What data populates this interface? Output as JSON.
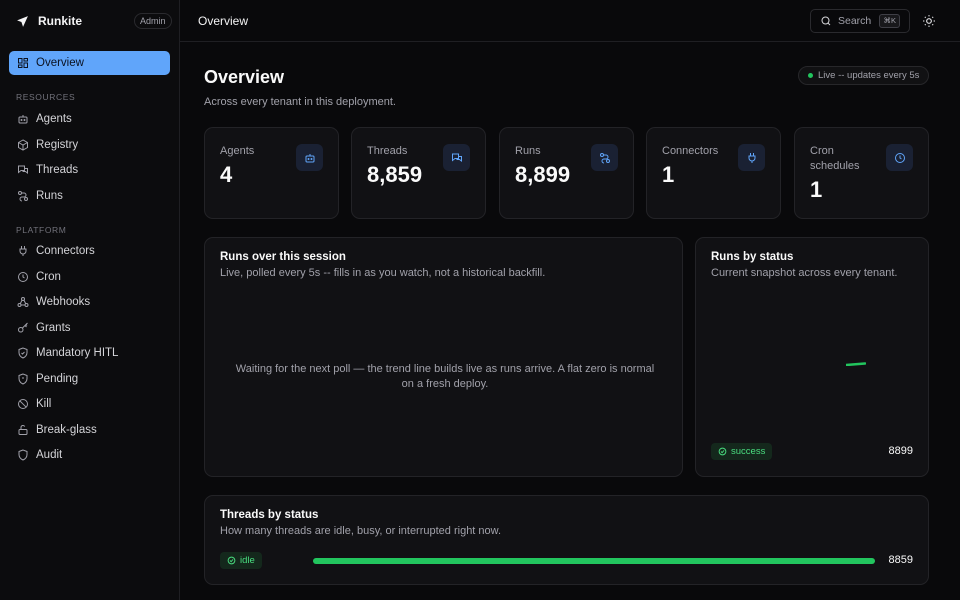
{
  "brand": {
    "name": "Runkite",
    "badge": "Admin"
  },
  "sidebar": {
    "overview": "Overview",
    "sections": [
      {
        "label": "RESOURCES",
        "items": [
          "Agents",
          "Registry",
          "Threads",
          "Runs"
        ]
      },
      {
        "label": "PLATFORM",
        "items": [
          "Connectors",
          "Cron",
          "Webhooks",
          "Grants",
          "Mandatory HITL",
          "Pending",
          "Kill",
          "Break-glass",
          "Audit"
        ]
      }
    ]
  },
  "topbar": {
    "title": "Overview",
    "search_label": "Search",
    "search_shortcut": "⌘K"
  },
  "page": {
    "title": "Overview",
    "subtitle": "Across every tenant in this deployment.",
    "live": "Live -- updates every 5s"
  },
  "stats": [
    {
      "label": "Agents",
      "value": "4",
      "icon": "bot-icon"
    },
    {
      "label": "Threads",
      "value": "8,859",
      "icon": "chat-icon"
    },
    {
      "label": "Runs",
      "value": "8,899",
      "icon": "route-icon"
    },
    {
      "label": "Connectors",
      "value": "1",
      "icon": "plug-icon"
    },
    {
      "label": "Cron schedules",
      "value": "1",
      "icon": "clock-icon"
    }
  ],
  "runs_session": {
    "title": "Runs over this session",
    "subtitle": "Live, polled every 5s -- fills in as you watch, not a historical backfill.",
    "empty": "Waiting for the next poll — the trend line builds live as runs arrive. A flat zero is normal on a fresh deploy."
  },
  "runs_status": {
    "title": "Runs by status",
    "subtitle": "Current snapshot across every tenant.",
    "status": "success",
    "count": "8899"
  },
  "threads_status": {
    "title": "Threads by status",
    "subtitle": "How many threads are idle, busy, or interrupted right now.",
    "status": "idle",
    "count": "8859",
    "fraction": 1.0
  },
  "colors": {
    "accent": "#60a5fa",
    "success": "#22c55e",
    "background": "#09090b"
  }
}
